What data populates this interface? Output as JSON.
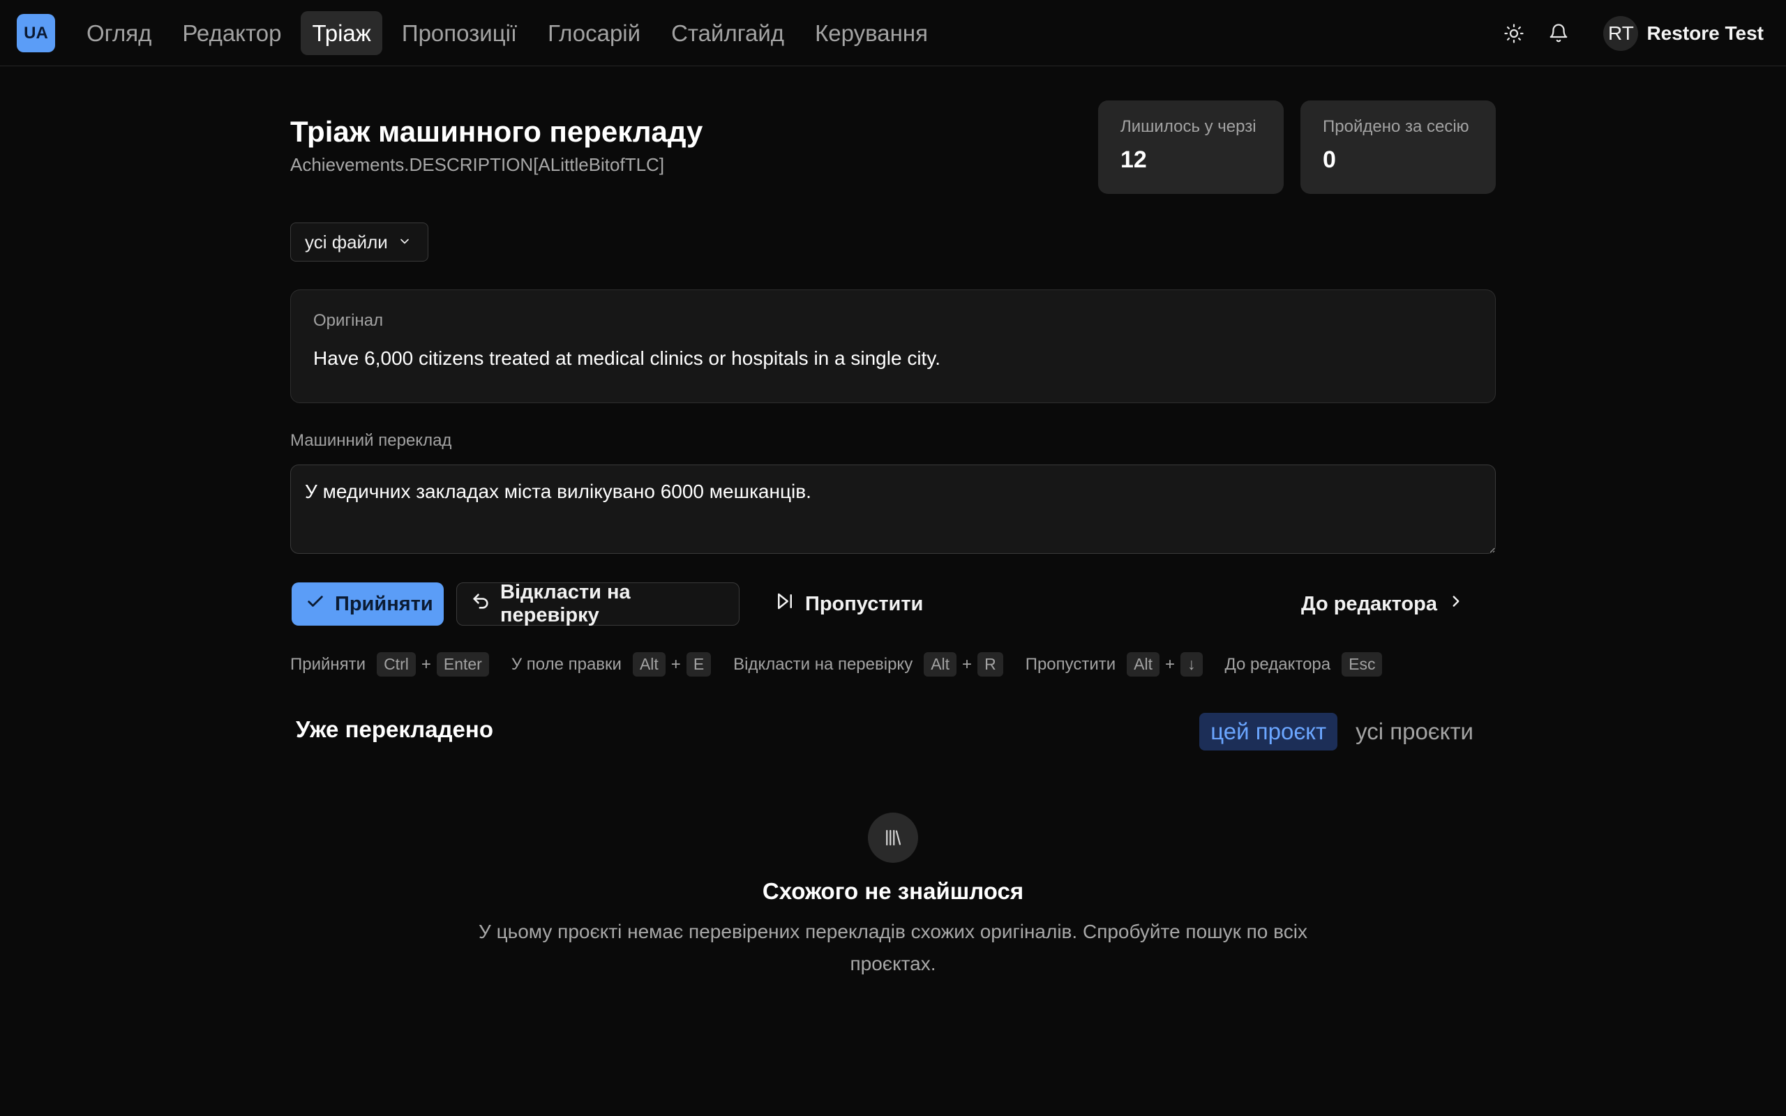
{
  "header": {
    "logo": "UA",
    "nav": [
      {
        "label": "Огляд",
        "active": false
      },
      {
        "label": "Редактор",
        "active": false
      },
      {
        "label": "Тріаж",
        "active": true
      },
      {
        "label": "Пропозиції",
        "active": false
      },
      {
        "label": "Глосарій",
        "active": false
      },
      {
        "label": "Стайлгайд",
        "active": false
      },
      {
        "label": "Керування",
        "active": false
      }
    ],
    "icons": [
      "sun-icon",
      "bell-icon"
    ],
    "user": {
      "initials": "RT",
      "name": "Restore Test"
    }
  },
  "page": {
    "title": "Тріаж машинного перекладу",
    "subtitle": "Achievements.DESCRIPTION[ALittleBitofTLC]"
  },
  "stats": {
    "remaining": {
      "label": "Лишилось у черзі",
      "value": "12"
    },
    "done": {
      "label": "Пройдено за сесію",
      "value": "0"
    }
  },
  "filter": {
    "files_label": "усі файли"
  },
  "original": {
    "label": "Оригінал",
    "text": "Have 6,000 citizens treated at medical clinics or hospitals in a single city."
  },
  "machine_translation": {
    "label": "Машинний переклад",
    "value": "У медичних закладах міста вилікувано 6000 мешканців."
  },
  "actions": {
    "accept": "Прийняти",
    "defer": "Відкласти на перевірку",
    "skip": "Пропустити",
    "to_editor": "До редактора"
  },
  "shortcuts": [
    {
      "label": "Прийняти",
      "keys": [
        "Ctrl",
        "Enter"
      ]
    },
    {
      "label": "У поле правки",
      "keys": [
        "Alt",
        "E"
      ]
    },
    {
      "label": "Відкласти на перевірку",
      "keys": [
        "Alt",
        "R"
      ]
    },
    {
      "label": "Пропустити",
      "keys": [
        "Alt",
        "↓"
      ]
    },
    {
      "label": "До редактора",
      "keys": [
        "Esc"
      ]
    }
  ],
  "already_translated": {
    "title": "Уже перекладено",
    "tabs": [
      {
        "label": "цей проєкт",
        "active": true
      },
      {
        "label": "усі проєкти",
        "active": false
      }
    ]
  },
  "empty_state": {
    "icon": "library-icon",
    "title": "Схожого не знайшлося",
    "description": "У цьому проєкті немає перевірених перекладів схожих оригіналів. Спробуйте пошук по всіх проєктах."
  },
  "colors": {
    "background": "#0a0a0a",
    "accent": "#5b9df7",
    "active_tab_bg": "#1c2e57",
    "active_tab_text": "#6ba6ff"
  }
}
